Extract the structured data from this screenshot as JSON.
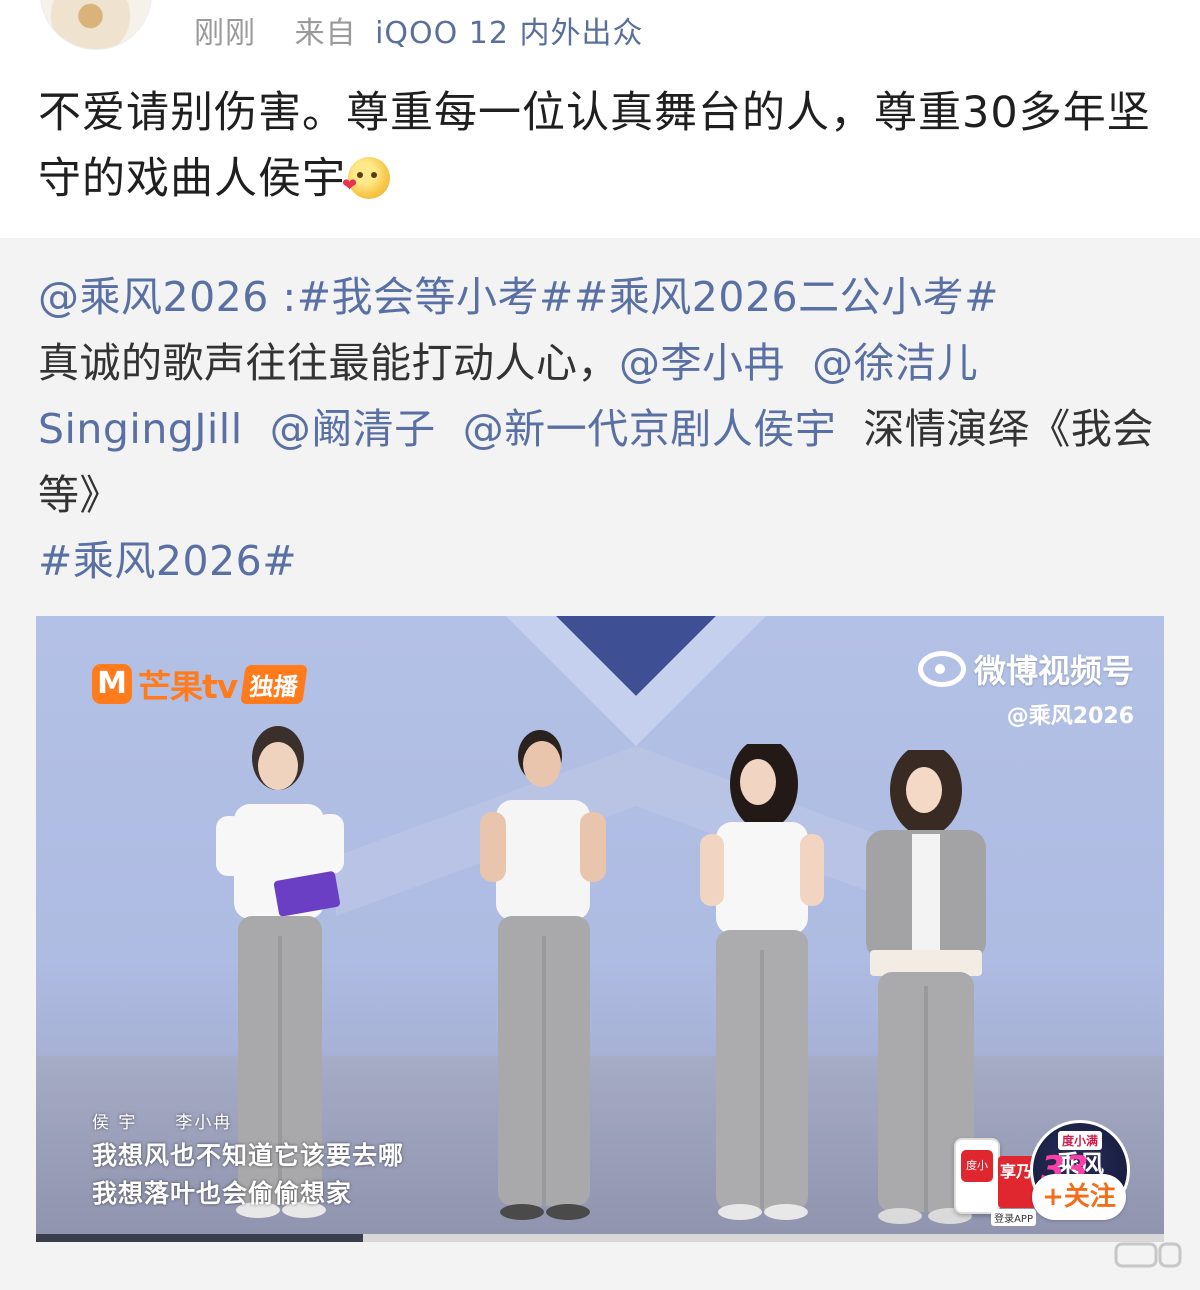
{
  "post": {
    "time": "刚刚",
    "source_prefix": "来自",
    "device": "iQOO 12 内外出众",
    "text": "不爱请别伤害。尊重每一位认真舞台的人，尊重30多年坚守的戏曲人侯宇"
  },
  "repost": {
    "author": "@乘风2026",
    "sep": " :",
    "hashtag1": "#我会等小考#",
    "hashtag2": "#乘风2026二公小考#",
    "line2_a": "真诚的歌声往往最能打动人心，",
    "mention1": "@李小冉",
    "mention2": "@徐洁儿SingingJill",
    "mention3": "@阚清子",
    "mention4": "@新一代京剧人侯宇",
    "tail": "深情演绎《我会等》",
    "hashtag3": "#乘风2026#"
  },
  "video": {
    "logo_text": "芒果tv",
    "logo_badge": "独播",
    "watermark_title": "微博视频号",
    "watermark_handle": "@乘风2026",
    "subtitle_names": "侯 宇　　李小冉",
    "subtitle_line1": "我想风也不知道它该要去哪",
    "subtitle_line2": "我想落叶也会偷偷想家",
    "badge_top": "度小满",
    "badge_title": "乘风",
    "badge_year": "2026",
    "promo_phone": "度小满",
    "promo_card": "享乃",
    "promo_login": "登录APP",
    "follow": "+关注",
    "progress": 0.29
  },
  "colors": {
    "link": "#5a6fa3",
    "meta": "#9a9a9a",
    "repost_bg": "#f3f3f4",
    "accent_orange": "#ff7b1c"
  }
}
